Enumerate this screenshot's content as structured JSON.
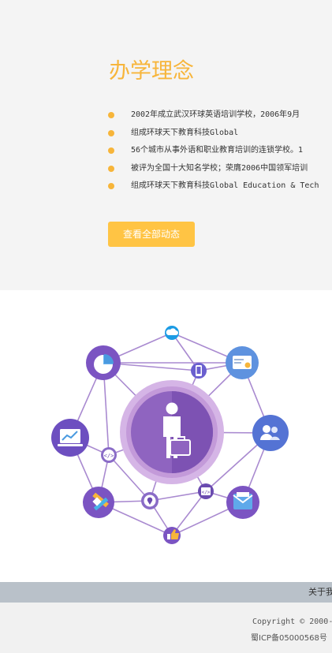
{
  "section": {
    "title": "办学理念",
    "items": [
      "2002年成立武汉环球英语培训学校，2006年9月",
      "组成环球天下教育科技Global",
      "56个城市从事外语和职业教育培训的连锁学校。1",
      "被评为全国十大知名学校；荣膺2006中国领军培训",
      "组成环球天下教育科技Global Education & Tech"
    ],
    "button_label": "查看全部动态"
  },
  "footer": {
    "link": "关于我",
    "copyright": "Copyright © 2000-",
    "icp": "蜀ICP备05000568号"
  },
  "colors": {
    "accent": "#f7b53a",
    "button": "#ffc444",
    "network_line": "#a98ad0",
    "footer_bar": "#b9c1c9"
  },
  "icons": [
    "cloud-icon",
    "pie-chart-icon",
    "mobile-icon",
    "card-icon",
    "users-icon",
    "analytics-icon",
    "code-icon",
    "tool-icon",
    "location-icon",
    "script-icon",
    "mail-icon",
    "thumbs-up-icon",
    "businessman-icon"
  ]
}
